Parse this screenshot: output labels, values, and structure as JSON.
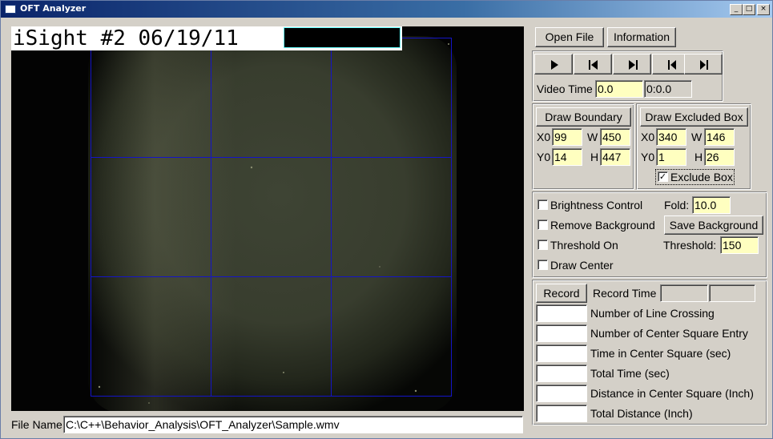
{
  "window": {
    "title": "OFT Analyzer",
    "minimize_glyph": "_",
    "restore_glyph": "□",
    "close_glyph": "×"
  },
  "video": {
    "overlay_text": "iSight #2 06/19/11"
  },
  "file": {
    "label": "File Name",
    "path": "C:\\C++\\Behavior_Analysis\\OFT_Analyzer\\Sample.wmv"
  },
  "toolbar": {
    "open_label": "Open File",
    "info_label": "Information"
  },
  "playback": {
    "icons": [
      "play-icon",
      "step-back-icon",
      "step-forward-icon",
      "skip-start-icon",
      "skip-end-icon"
    ],
    "video_time_label": "Video Time",
    "video_time_value": "0.0",
    "video_time_clock": "0:0.0"
  },
  "boundary": {
    "button_label": "Draw Boundary",
    "x0_label": "X0",
    "x0": "99",
    "w_label": "W",
    "w": "450",
    "y0_label": "Y0",
    "y0": "14",
    "h_label": "H",
    "h": "447"
  },
  "excluded": {
    "button_label": "Draw Excluded Box",
    "x0_label": "X0",
    "x0": "340",
    "w_label": "W",
    "w": "146",
    "y0_label": "Y0",
    "y0": "1",
    "h_label": "H",
    "h": "26",
    "exclude_label": "Exclude Box",
    "exclude_checked": true
  },
  "processing": {
    "brightness_label": "Brightness Control",
    "fold_label": "Fold:",
    "fold_value": "10.0",
    "remove_bg_label": "Remove Background",
    "save_bg_label": "Save Background",
    "threshold_on_label": "Threshold On",
    "threshold_label": "Threshold:",
    "threshold_value": "150",
    "draw_center_label": "Draw Center"
  },
  "recording": {
    "record_label": "Record",
    "record_time_label": "Record Time",
    "record_time_a": "",
    "record_time_b": "",
    "metrics": [
      {
        "label": "Number of Line Crossing",
        "value": ""
      },
      {
        "label": "Number of Center Square Entry",
        "value": ""
      },
      {
        "label": "Time in Center Square (sec)",
        "value": ""
      },
      {
        "label": "Total Time (sec)",
        "value": ""
      },
      {
        "label": "Distance in Center Square (Inch)",
        "value": ""
      },
      {
        "label": "Total Distance (Inch)",
        "value": ""
      }
    ]
  },
  "colors": {
    "titlebar_start": "#0a246a",
    "field_bg": "#ffffc0",
    "grid_line": "#1010c8",
    "arena": "#3b4031"
  }
}
